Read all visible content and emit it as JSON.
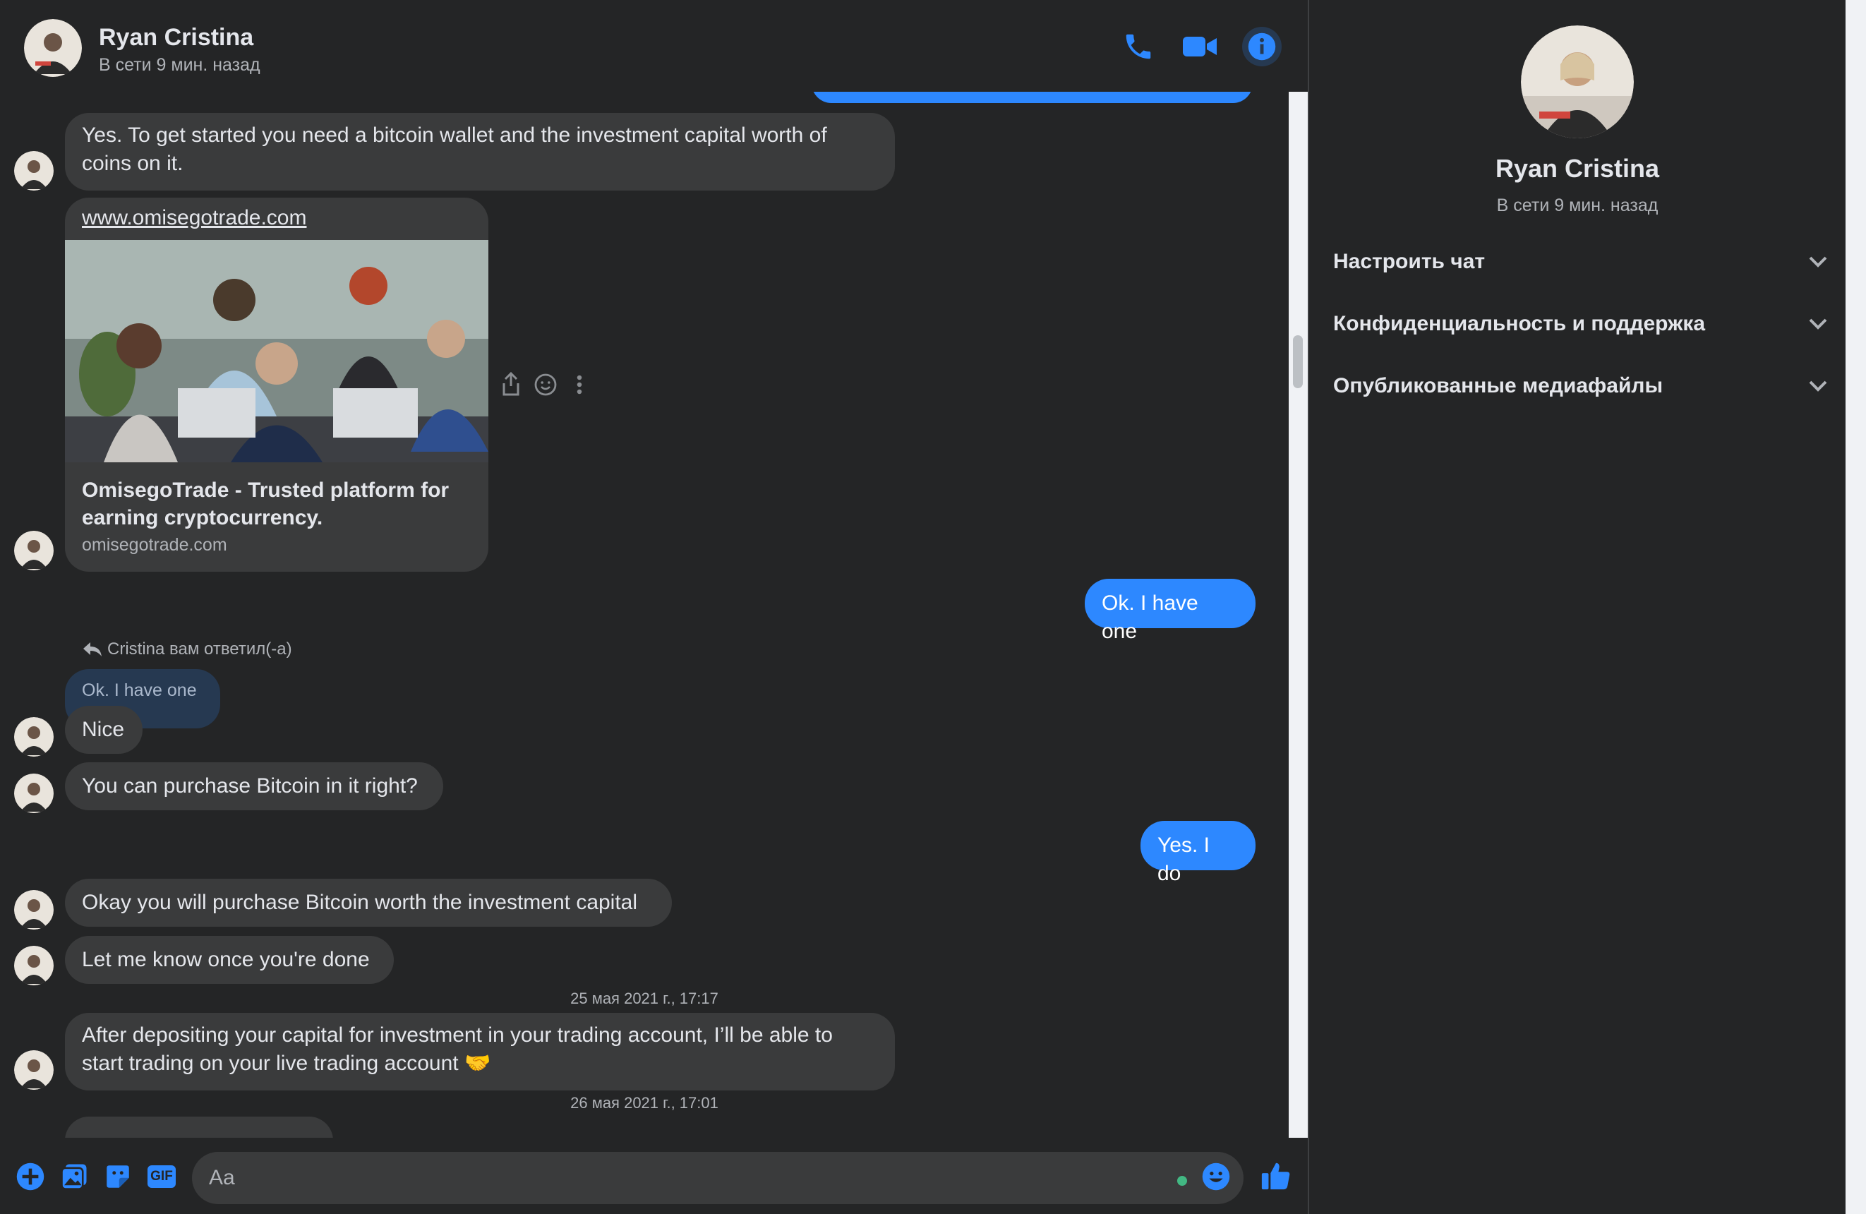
{
  "contact": {
    "name": "Ryan Cristina",
    "status": "В сети 9 мин. назад"
  },
  "header_icons": [
    "phone-icon",
    "video-camera-icon",
    "info-icon"
  ],
  "messages": {
    "m1": "Yes. To get started you need a bitcoin wallet and the investment capital worth of coins on it.",
    "link_url": "www.omisegotrade.com",
    "link_title": "OmisegoTrade - Trusted platform for earning cryptocurrency.",
    "link_domain": "omisegotrade.com",
    "out1": "Ok. I have one",
    "reply_label": "Cristina вам ответил(-а)",
    "reply_quote": "Ok. I have one",
    "m2": "Nice",
    "m3": "You can purchase Bitcoin in it right?",
    "out2": "Yes. I do",
    "m4": "Okay you will purchase Bitcoin worth the investment capital",
    "m5": "Let me know once you're done",
    "ts1": "25 мая 2021 г., 17:17",
    "m6": "After depositing your capital for investment in your trading account, I’ll be able to start trading on your live trading account 🤝",
    "ts2": "26 мая 2021 г., 17:01"
  },
  "composer": {
    "placeholder": "Aa",
    "tools": [
      "add-icon",
      "gallery-icon",
      "sticker-icon",
      "gif-icon"
    ],
    "gif_label": "GIF"
  },
  "info_panel": {
    "name": "Ryan Cristina",
    "status": "В сети 9 мин. назад",
    "sections": [
      {
        "label": "Настроить чат"
      },
      {
        "label": "Конфиденциальность и поддержка"
      },
      {
        "label": "Опубликованные медиафайлы"
      }
    ]
  },
  "colors": {
    "background": "#242526",
    "bubble_in": "#3a3b3c",
    "bubble_out": "#2d88ff",
    "accent": "#2d88ff"
  }
}
